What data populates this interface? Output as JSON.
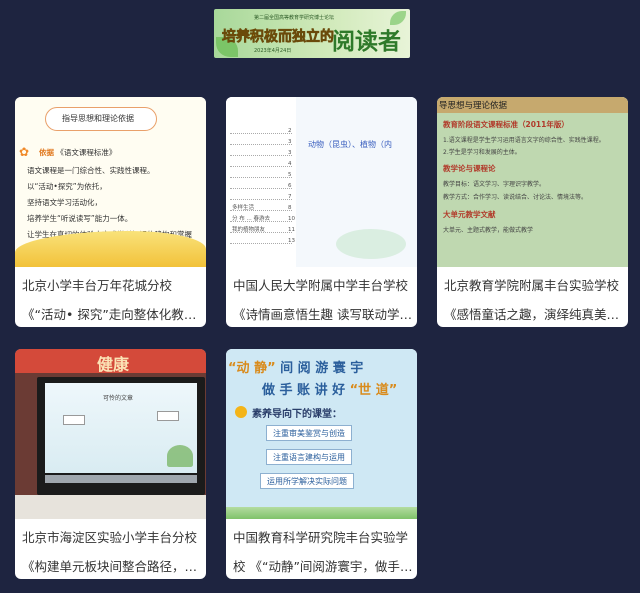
{
  "banner": {
    "small_text": "第二届全国高等教育学研究博士论坛",
    "left_title": "培养积极而独立的",
    "big_title": "阅读者",
    "date": "2023年4月24日"
  },
  "cards": [
    {
      "school": "北京小学丰台万年花城分校",
      "title": "《“活动• 探究”走向整体化教学》",
      "thumb": {
        "header": "指导思想和理论依据",
        "basis": "《语文课程标准》",
        "lines": [
          "语文课程是一门综合性、实践性课程。",
          "以“活动•探究”为依托，",
          "坚持语文学习活动化，",
          "培养学生“听说读写”能力一体。",
          "让学生在真切的体验中完成学科知识的建构和掌握"
        ]
      }
    },
    {
      "school": "中国人民大学附属中学丰台学校",
      "title": "《诗情画意悟生趣 读写联动学表达》",
      "thumb": {
        "blue_text": "动物（昆虫）、植物（内",
        "rows": [
          "",
          "",
          "",
          "",
          "",
          "",
          "",
          "",
          "",
          "",
          "多样生活",
          "分 布 ... 春游去",
          "我的植物朋友"
        ]
      }
    },
    {
      "school": "北京教育学院附属丰台实验学校",
      "title": "《感悟童话之趣，演绎纯真美好》",
      "thumb": {
        "top": "导思想与理论依据",
        "sections": [
          "教育阶段语文课程标准（2011年版）",
          "教学论与课程论",
          "大单元教学文献"
        ],
        "texts": [
          "1.语文课程是学生学习运用语言文字的综合性、实践性课程。",
          "2.学生是学习和发展的主体。",
          "教学目标：语文学习、字理识字教学。",
          "教学方式：合作学习、读说结合、讨论法、情境法等。",
          "大单元、主题式教学，能做式教学"
        ]
      }
    },
    {
      "school": "北京市海淀区实验小学丰台分校",
      "title": "《构建单元板块间整合路径，促进学生语文素养提升》",
      "thumb": {
        "wall_text": "健康",
        "screen_caption": "可怜的文章"
      }
    },
    {
      "school": "中国教育科学研究院丰台实验学",
      "title": "校 《“动静”间阅游寰宇，做手账讲好“世道”》",
      "thumb": {
        "line1_a": "“动 静”",
        "line1_b": "间 阅 游 寰 宇",
        "line2_a": "做 手 账 讲 好",
        "line2_b": "“世 道”",
        "subtitle": "素养导向下的课堂：",
        "boxes": [
          "注重审美鉴赏与创造",
          "注重语言建构与运用",
          "运用所学解决实际问题"
        ]
      }
    }
  ]
}
